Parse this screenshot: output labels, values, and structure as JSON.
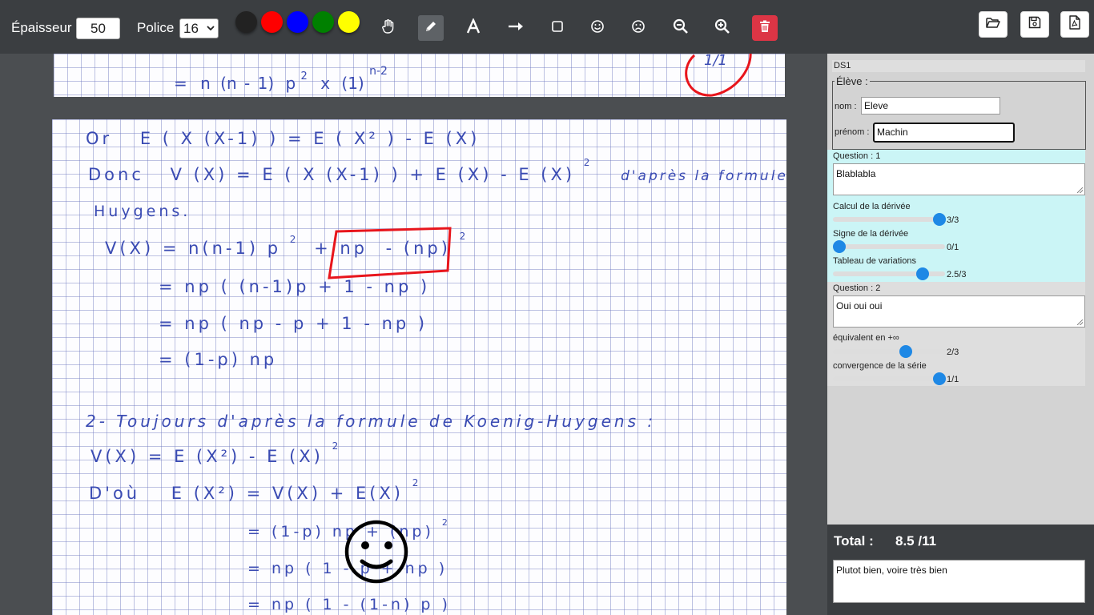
{
  "toolbar": {
    "thickness_label": "Épaisseur",
    "thickness_value": "50",
    "font_label": "Police",
    "font_value": "16",
    "colors": [
      "#222222",
      "#ff0000",
      "#0000ff",
      "#008000",
      "#ffff00"
    ]
  },
  "page1": {
    "line": [
      "=",
      "n",
      "(n",
      "-",
      "1)",
      "p",
      "2",
      "x",
      "(1)",
      "n-2"
    ],
    "annotation": "1/1"
  },
  "page2": {
    "lines": [
      {
        "parts": [
          "Or",
          "E ( X (X-1) ) = E ( X² ) - E (X)"
        ]
      },
      {
        "parts": [
          "Donc",
          "V (X) = E ( X (X-1) ) + E (X) - E (X)",
          "2",
          "d'après la formule de Koenig-"
        ]
      },
      {
        "parts": [
          "Huygens."
        ]
      },
      {
        "parts": [
          "V(X) = n(n-1) p",
          "2",
          "+ np",
          "- (np)",
          "2"
        ]
      },
      {
        "parts": [
          "= np ( (n-1)p + 1 - np )"
        ]
      },
      {
        "parts": [
          "= np ( np - p + 1 - np )"
        ]
      },
      {
        "parts": [
          "= (1-p) np"
        ]
      },
      {
        "parts": [
          "2- Toujours d'après la formule de Koenig-Huygens :"
        ]
      },
      {
        "parts": [
          "V(X) = E (X²) - E (X)",
          "2"
        ]
      },
      {
        "parts": [
          "D'où",
          "E (X²) = V(X) + E(X)",
          "2"
        ]
      },
      {
        "parts": [
          "= (1-p) np + (np)",
          "2"
        ]
      },
      {
        "parts": [
          "= np ( 1 - p + np )"
        ]
      },
      {
        "parts": [
          "= np ( 1 - (1-n) p )"
        ]
      }
    ]
  },
  "panel": {
    "exam_title": "DS1",
    "student": {
      "legend": "Élève :",
      "name_label": "nom :",
      "name_value": "Eleve",
      "firstname_label": "prénom :",
      "firstname_value": "Machin"
    },
    "questions": [
      {
        "title": "Question : 1",
        "answer": "Blablabla",
        "criteria": [
          {
            "label": "Calcul de la dérivée",
            "score": "3/3",
            "value": 3,
            "max": 3
          },
          {
            "label": "Signe de la dérivée",
            "score": "0/1",
            "value": 0,
            "max": 1
          },
          {
            "label": "Tableau de variations",
            "score": "2.5/3",
            "value": 2.5,
            "max": 3
          }
        ]
      },
      {
        "title": "Question : 2",
        "answer": "Oui oui oui",
        "criteria": [
          {
            "label": "équivalent en +∞",
            "score": "2/3",
            "value": 2,
            "max": 3
          },
          {
            "label": "convergence de la série",
            "score": "1/1",
            "value": 1,
            "max": 1
          }
        ]
      }
    ]
  },
  "footer": {
    "total_label": "Total :",
    "total_value": "8.5 /11",
    "comment": "Plutot bien, voire très bien"
  }
}
